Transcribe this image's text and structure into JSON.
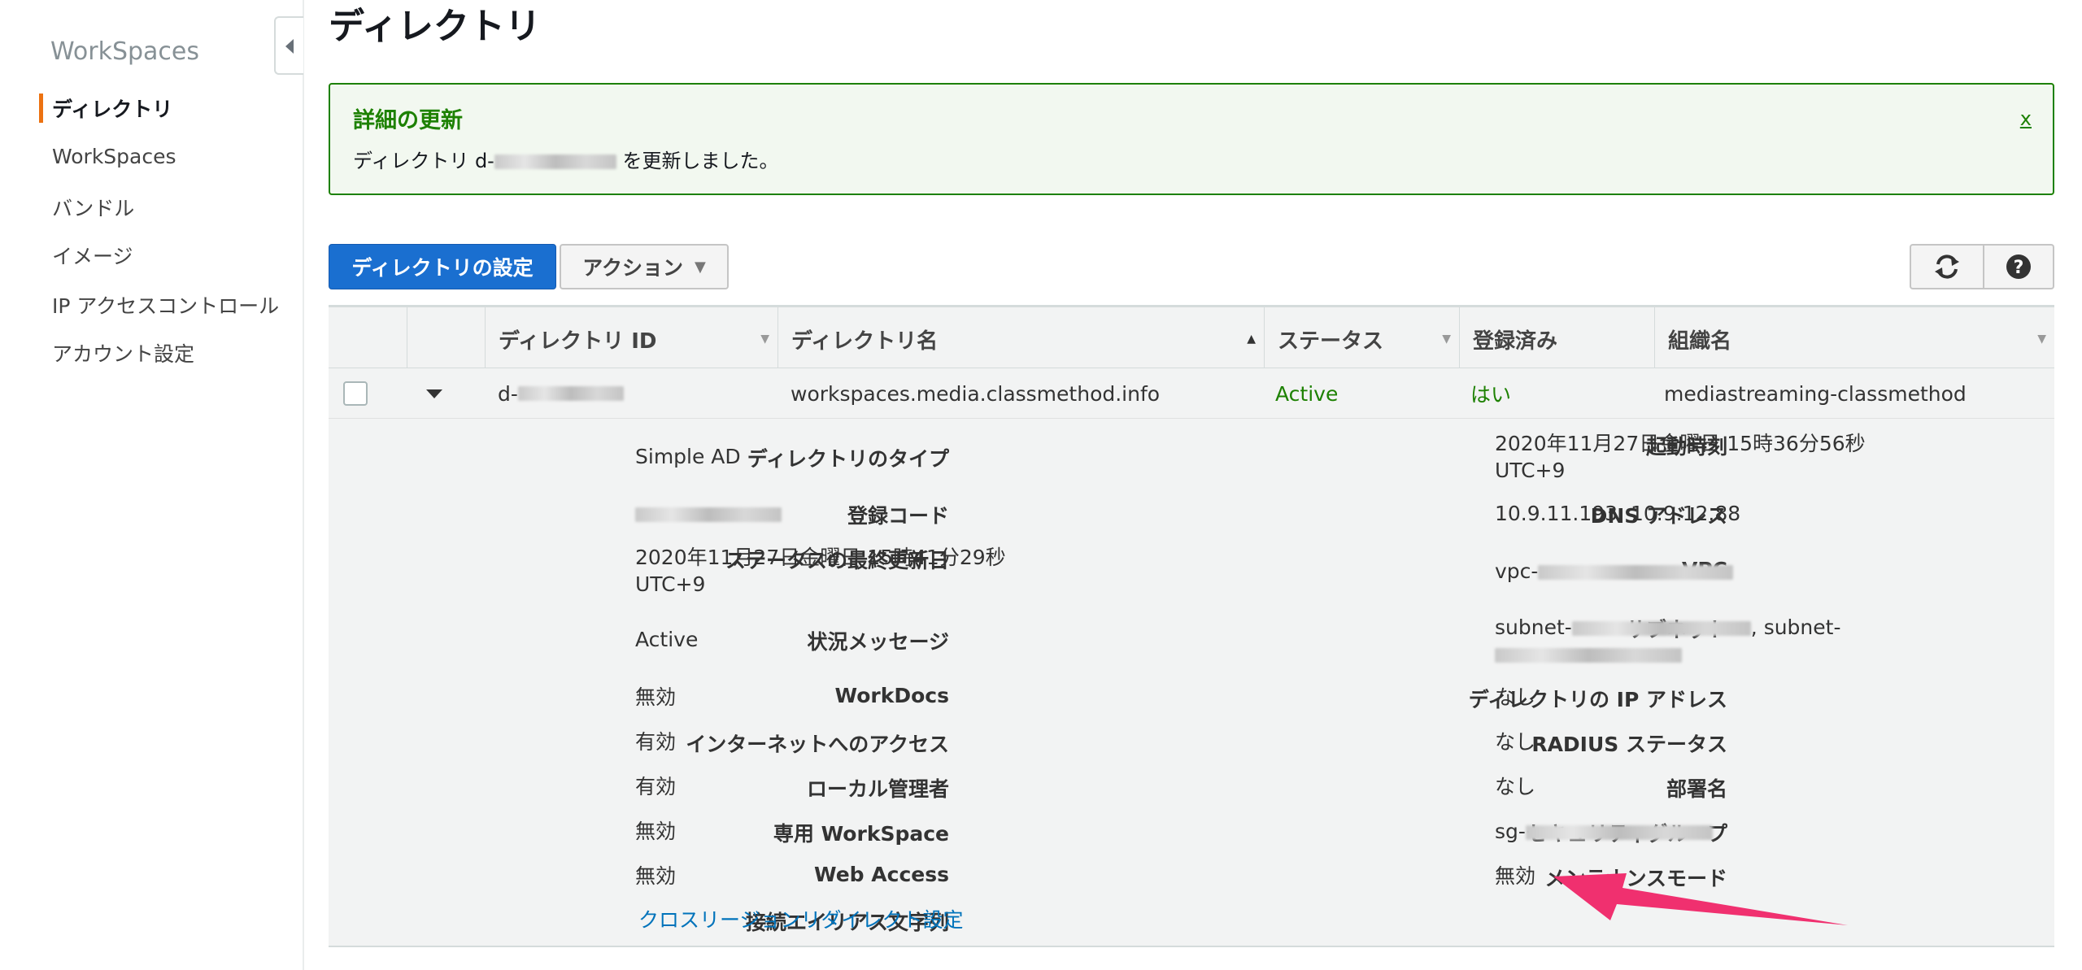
{
  "sidebar": {
    "title": "WorkSpaces",
    "items": [
      {
        "label": "ディレクトリ"
      },
      {
        "label": "WorkSpaces"
      },
      {
        "label": "バンドル"
      },
      {
        "label": "イメージ"
      },
      {
        "label": "IP アクセスコントロール"
      },
      {
        "label": "アカウント設定"
      }
    ]
  },
  "page": {
    "title": "ディレクトリ"
  },
  "flash": {
    "title": "詳細の更新",
    "body_prefix": "ディレクトリ d-",
    "body_suffix": "を更新しました。",
    "close": "x"
  },
  "toolbar": {
    "setup_label": "ディレクトリの設定",
    "actions_label": "アクション",
    "refresh_icon": "refresh-icon",
    "help_icon": "help-icon"
  },
  "table": {
    "columns": [
      "ディレクトリ ID",
      "ディレクトリ名",
      "ステータス",
      "登録済み",
      "組織名"
    ],
    "row": {
      "id_prefix": "d-",
      "name": "workspaces.media.classmethod.info",
      "status": "Active",
      "registered": "はい",
      "org": "mediastreaming-classmethod"
    }
  },
  "details": {
    "left": [
      {
        "label": "ディレクトリのタイプ",
        "value": "Simple AD"
      },
      {
        "label": "登録コード",
        "value": ""
      },
      {
        "label": "ステータスの最終更新日",
        "value": "2020年11月27日金曜日 15時41分29秒",
        "value2": "UTC+9"
      },
      {
        "label": "状況メッセージ",
        "value": "Active"
      },
      {
        "label": "WorkDocs",
        "value": "無効"
      },
      {
        "label": "インターネットへのアクセス",
        "value": "有効"
      },
      {
        "label": "ローカル管理者",
        "value": "有効"
      },
      {
        "label": "専用 WorkSpace",
        "value": "無効"
      },
      {
        "label": "Web Access",
        "value": "無効"
      },
      {
        "label": "接続エイリアス文字列",
        "value": "クロスリージョンリダイレクト設定"
      }
    ],
    "right": [
      {
        "label": "起動時刻",
        "value": "2020年11月27日金曜日 15時36分56秒",
        "value2": "UTC+9"
      },
      {
        "label": "DNS アドレス",
        "value": "10.9.11.193, 10.9.12.88"
      },
      {
        "label": "VPC",
        "value": "vpc-"
      },
      {
        "label": "サブネット",
        "value": "subnet-",
        "value_mid": ", subnet-"
      },
      {
        "label": "ディレクトリの IP アドレス",
        "value": "なし"
      },
      {
        "label": "RADIUS ステータス",
        "value": "なし"
      },
      {
        "label": "部署名",
        "value": "なし"
      },
      {
        "label": "セキュリティグループ",
        "value": "sg-"
      },
      {
        "label": "メンテナンスモード",
        "value": "無効"
      }
    ]
  },
  "colors": {
    "accent": "#ec7211",
    "primary": "#1a6fd0",
    "success": "#1d8102",
    "annotation": "#f0306f"
  }
}
